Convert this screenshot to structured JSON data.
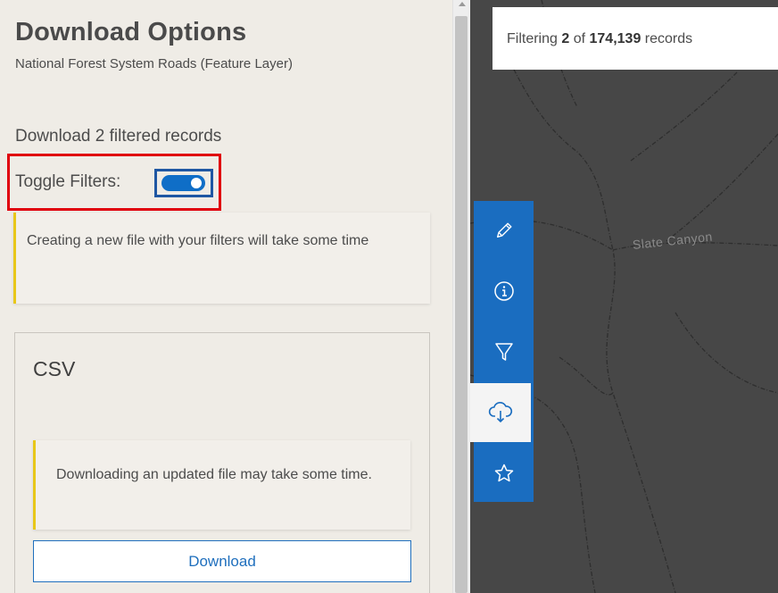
{
  "panel": {
    "title": "Download Options",
    "subtitle": "National Forest System Roads (Feature Layer)",
    "download_count_text": "Download 2 filtered records",
    "toggle": {
      "label": "Toggle Filters:",
      "on": true
    },
    "notice_filters": "Creating a new file with your filters will take some time",
    "csv": {
      "title": "CSV",
      "notice": "Downloading an updated file may take some time.",
      "download_label": "Download"
    }
  },
  "map": {
    "label": "Slate Canyon",
    "filter_status": {
      "prefix": "Filtering ",
      "filtered": "2",
      "middle": " of ",
      "total": "174,139",
      "suffix": " records"
    }
  },
  "toolbar": {
    "items": [
      {
        "icon": "pencil-icon",
        "active": false
      },
      {
        "icon": "info-icon",
        "active": false
      },
      {
        "icon": "filter-icon",
        "active": false
      },
      {
        "icon": "cloud-download-icon",
        "active": true
      },
      {
        "icon": "star-icon",
        "active": false
      }
    ]
  },
  "colors": {
    "accent": "#1a6dc0",
    "highlight_border": "#e0000d",
    "notice_bar": "#e8c719",
    "panel_bg": "#efece6",
    "map_bg": "#474747"
  }
}
